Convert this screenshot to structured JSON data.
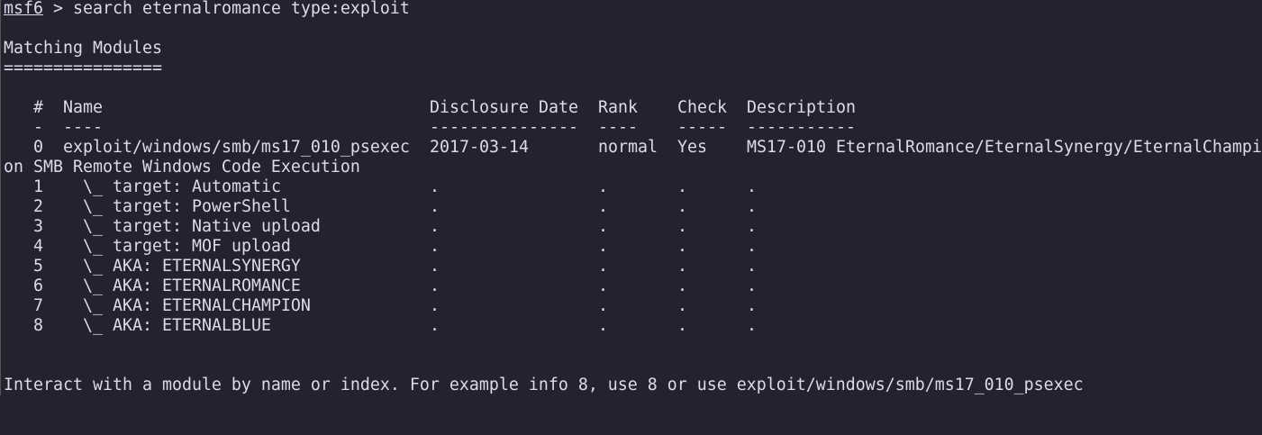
{
  "prompt": {
    "name": "msf6",
    "separator": ">",
    "command": "search eternalromance type:exploit"
  },
  "heading": {
    "title": "Matching Modules",
    "underline": "================"
  },
  "table": {
    "headers": {
      "index": "#",
      "name": "Name",
      "date": "Disclosure Date",
      "rank": "Rank",
      "check": "Check",
      "description": "Description"
    },
    "dividers": {
      "index": "-",
      "name": "----",
      "date": "---------------",
      "rank": "----",
      "check": "-----",
      "description": "-----------"
    },
    "main_row": {
      "index": "0",
      "name": "exploit/windows/smb/ms17_010_psexec",
      "date": "2017-03-14",
      "rank": "normal",
      "check": "Yes",
      "description_line1": "MS17-010 EternalRomance/EternalSynergy/EternalChampi",
      "description_line2": "on SMB Remote Windows Code Execution"
    },
    "sub_rows": [
      {
        "index": "1",
        "name": "\\_ target: Automatic",
        "date": ".",
        "rank": ".",
        "check": ".",
        "description": "."
      },
      {
        "index": "2",
        "name": "\\_ target: PowerShell",
        "date": ".",
        "rank": ".",
        "check": ".",
        "description": "."
      },
      {
        "index": "3",
        "name": "\\_ target: Native upload",
        "date": ".",
        "rank": ".",
        "check": ".",
        "description": "."
      },
      {
        "index": "4",
        "name": "\\_ target: MOF upload",
        "date": ".",
        "rank": ".",
        "check": ".",
        "description": "."
      },
      {
        "index": "5",
        "name": "\\_ AKA: ETERNALSYNERGY",
        "date": ".",
        "rank": ".",
        "check": ".",
        "description": "."
      },
      {
        "index": "6",
        "name": "\\_ AKA: ETERNALROMANCE",
        "date": ".",
        "rank": ".",
        "check": ".",
        "description": "."
      },
      {
        "index": "7",
        "name": "\\_ AKA: ETERNALCHAMPION",
        "date": ".",
        "rank": ".",
        "check": ".",
        "description": "."
      },
      {
        "index": "8",
        "name": "\\_ AKA: ETERNALBLUE",
        "date": ".",
        "rank": ".",
        "check": ".",
        "description": "."
      }
    ]
  },
  "footer": {
    "hint": "Interact with a module by name or index. For example info 8, use 8 or use exploit/windows/smb/ms17_010_psexec"
  }
}
